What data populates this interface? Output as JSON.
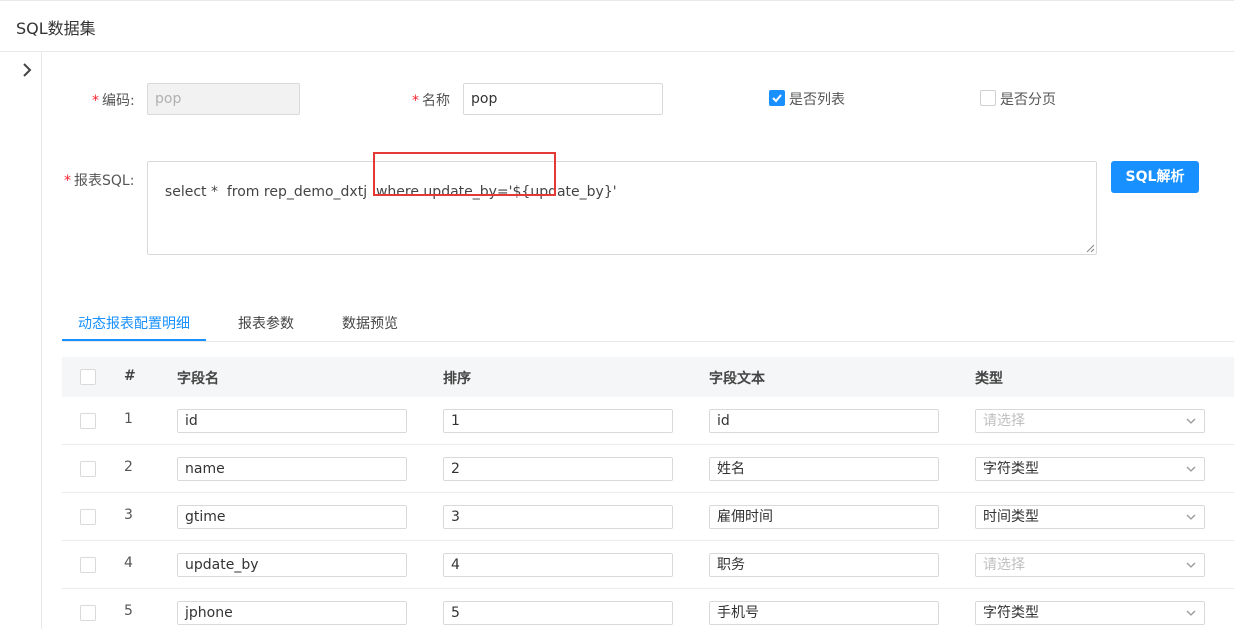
{
  "page": {
    "title": "SQL数据集"
  },
  "form": {
    "code": {
      "label": "编码:",
      "value": "pop"
    },
    "name": {
      "label": "名称",
      "value": "pop"
    },
    "is_list": {
      "label": "是否列表",
      "checked": true
    },
    "is_paged": {
      "label": "是否分页",
      "checked": false
    },
    "sql": {
      "label": "报表SQL:",
      "value": "select *  from rep_demo_dxtj  where update_by='${update_by}'"
    },
    "required_mark": "*",
    "parse_button": "SQL解析"
  },
  "tabs": [
    {
      "label": "动态报表配置明细",
      "active": true
    },
    {
      "label": "报表参数",
      "active": false
    },
    {
      "label": "数据预览",
      "active": false
    }
  ],
  "table": {
    "headers": {
      "index": "#",
      "field_name": "字段名",
      "order": "排序",
      "field_text": "字段文本",
      "type": "类型"
    },
    "select_placeholder": "请选择",
    "rows": [
      {
        "index": "1",
        "field_name": "id",
        "order": "1",
        "field_text": "id",
        "type": "请选择",
        "type_is_placeholder": true
      },
      {
        "index": "2",
        "field_name": "name",
        "order": "2",
        "field_text": "姓名",
        "type": "字符类型",
        "type_is_placeholder": false
      },
      {
        "index": "3",
        "field_name": "gtime",
        "order": "3",
        "field_text": "雇佣时间",
        "type": "时间类型",
        "type_is_placeholder": false
      },
      {
        "index": "4",
        "field_name": "update_by",
        "order": "4",
        "field_text": "职务",
        "type": "请选择",
        "type_is_placeholder": true
      },
      {
        "index": "5",
        "field_name": "jphone",
        "order": "5",
        "field_text": "手机号",
        "type": "字符类型",
        "type_is_placeholder": false
      }
    ]
  },
  "colors": {
    "primary": "#1890ff",
    "required": "#f5222d",
    "highlight": "#e53935"
  }
}
